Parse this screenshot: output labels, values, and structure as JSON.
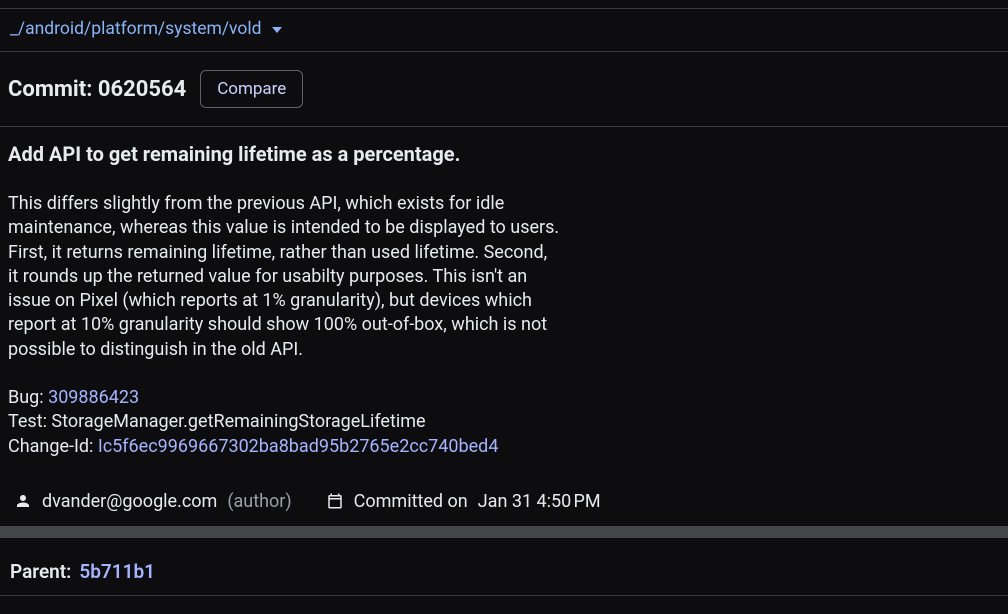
{
  "breadcrumb": {
    "path": "_/android/platform/system/vold"
  },
  "commit": {
    "label": "Commit:",
    "hash": "0620564",
    "compare_label": "Compare"
  },
  "message": {
    "title": "Add API to get remaining lifetime as a percentage.",
    "body": "This differs slightly from the previous API, which exists for idle\nmaintenance, whereas this value is intended to be displayed to users.\nFirst, it returns remaining lifetime, rather than used lifetime. Second,\nit rounds up the returned value for usabilty purposes. This isn't an\nissue on Pixel (which reports at 1% granularity), but devices which\nreport at 10% granularity should show 100% out-of-box, which is not\npossible to distinguish in the old API.",
    "bug_label": "Bug: ",
    "bug_id": "309886423",
    "test_line": "Test: StorageManager.getRemainingStorageLifetime",
    "changeid_label": "Change-Id: ",
    "changeid": "Ic5f6ec9969667302ba8bad95b2765e2cc740bed4"
  },
  "author": {
    "email": "dvander@google.com",
    "role": "(author)",
    "committed_label": "Committed on",
    "date": "Jan 31 4:50 PM"
  },
  "parent": {
    "label": "Parent:",
    "hash": "5b711b1"
  }
}
